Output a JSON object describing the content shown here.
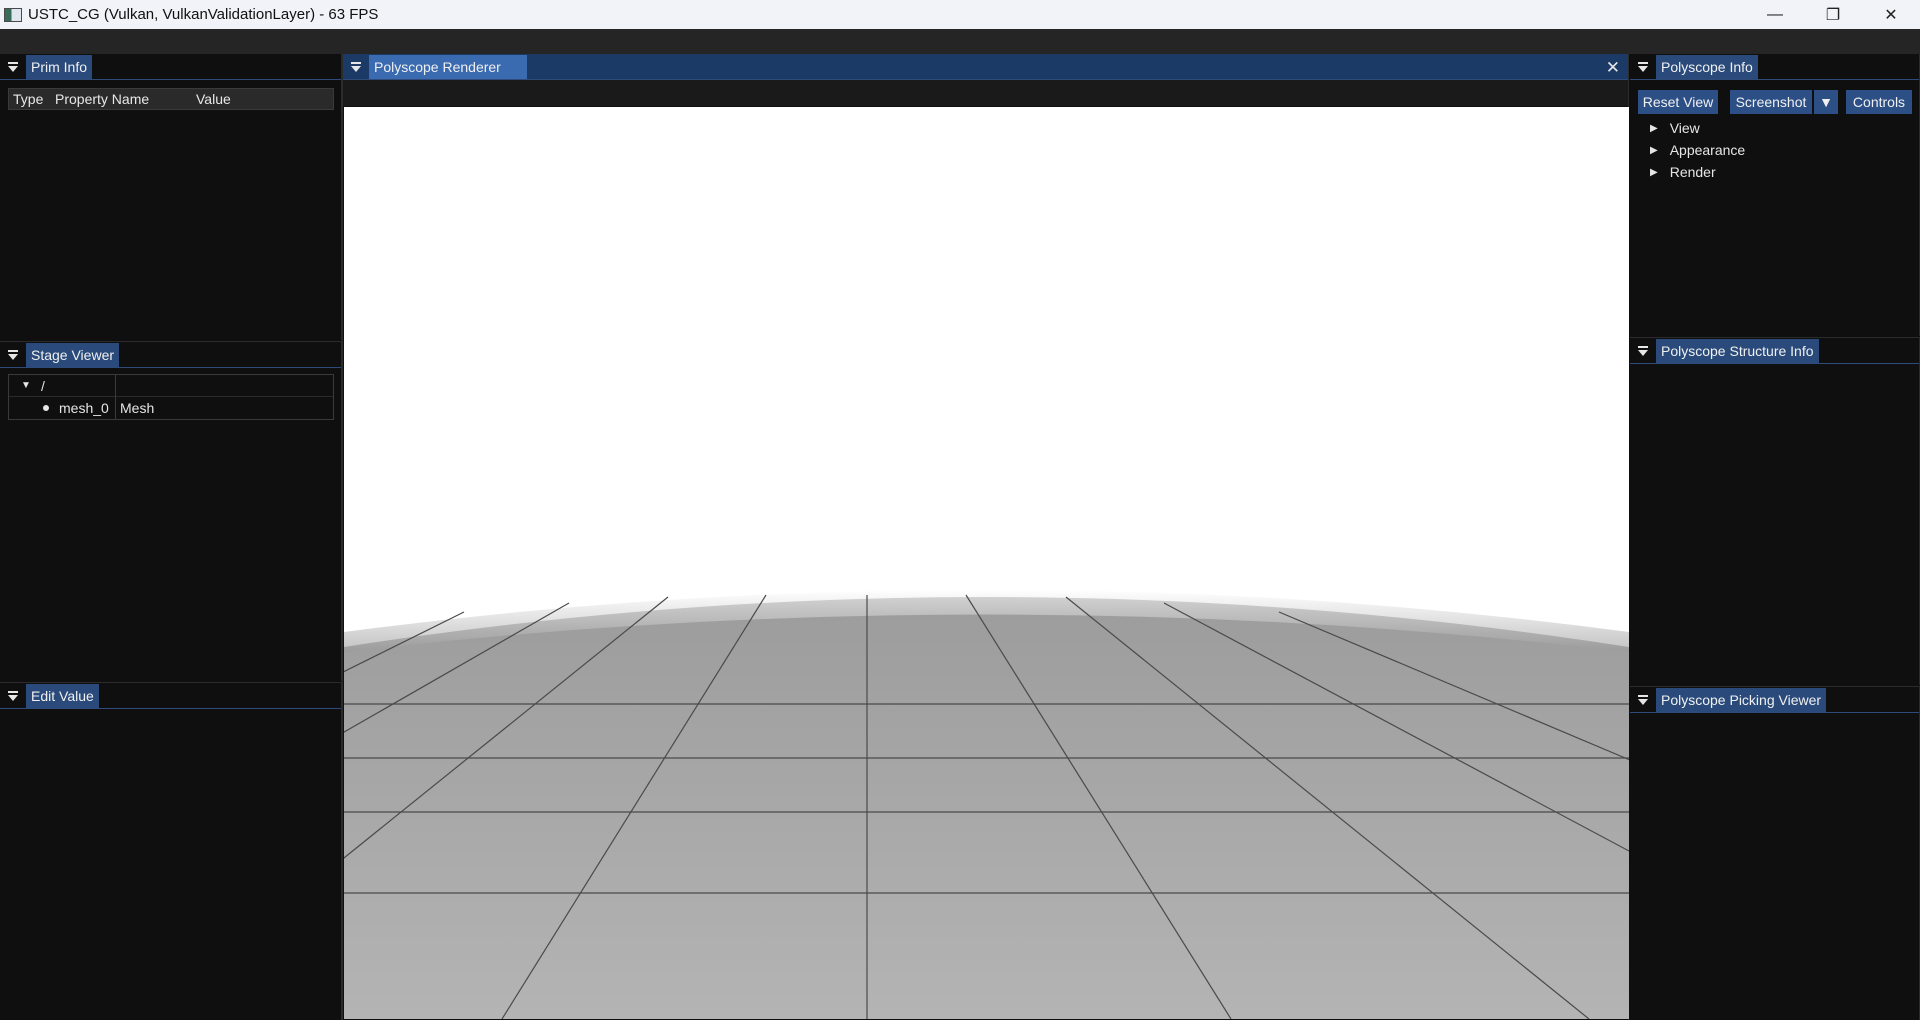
{
  "window": {
    "title": "USTC_CG (Vulkan, VulkanValidationLayer) - 63 FPS",
    "minimize_glyph": "—",
    "maximize_glyph": "❐",
    "close_glyph": "✕"
  },
  "prim_info": {
    "title": "Prim Info",
    "columns": [
      "Type",
      "Property Name",
      "Value"
    ]
  },
  "stage_viewer": {
    "title": "Stage Viewer",
    "root": {
      "arrow": "▼",
      "label": "/"
    },
    "items": [
      {
        "label": "mesh_0",
        "type": "Mesh"
      }
    ]
  },
  "edit_value": {
    "title": "Edit Value"
  },
  "renderer": {
    "title": "Polyscope Renderer",
    "close_glyph": "✕"
  },
  "polyscope_info": {
    "title": "Polyscope Info",
    "buttons": {
      "reset_view": "Reset View",
      "screenshot": "Screenshot",
      "dropdown": "▼",
      "controls": "Controls"
    },
    "sections": [
      {
        "label": "View"
      },
      {
        "label": "Appearance"
      },
      {
        "label": "Render"
      }
    ],
    "section_arrow": "▶"
  },
  "structure_info": {
    "title": "Polyscope Structure Info"
  },
  "picking_viewer": {
    "title": "Polyscope Picking Viewer"
  },
  "colors": {
    "accent": "#294a7a",
    "accent_active": "#3a6ab0",
    "panel_bg": "#0f0f0f",
    "ground": "#a8a8a8"
  }
}
